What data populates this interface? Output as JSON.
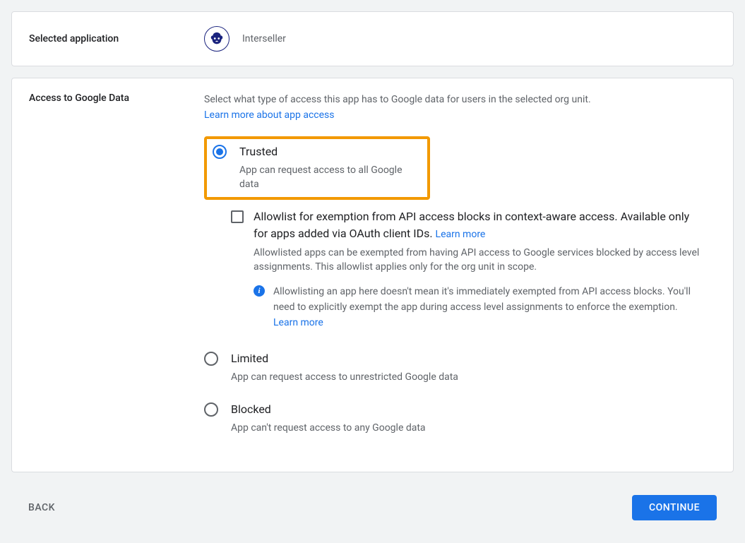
{
  "selected_app": {
    "section_label": "Selected application",
    "app_name": "Interseller",
    "icon_name": "bear-logo-icon"
  },
  "access": {
    "section_label": "Access to Google Data",
    "description": "Select what type of access this app has to Google data for users in the selected org unit.",
    "learn_more_link": "Learn more about app access",
    "options": {
      "trusted": {
        "title": "Trusted",
        "subtitle": "App can request access to all Google data",
        "selected": true
      },
      "allowlist": {
        "title_part1": "Allowlist for exemption from API access blocks in context-aware access. Available only for apps added via OAuth client IDs. ",
        "learn_more": "Learn more",
        "description": "Allowlisted apps can be exempted from having API access to Google services blocked by access level assignments. This allowlist applies only for the org unit in scope.",
        "info_text": "Allowlisting an app here doesn't mean it's immediately exempted from API access blocks. You'll need to explicitly exempt the app during access level assignments to enforce the exemption. ",
        "info_learn_more": "Learn more"
      },
      "limited": {
        "title": "Limited",
        "subtitle": "App can request access to unrestricted Google data"
      },
      "blocked": {
        "title": "Blocked",
        "subtitle": "App can't request access to any Google data"
      }
    }
  },
  "footer": {
    "back": "BACK",
    "continue": "CONTINUE"
  }
}
